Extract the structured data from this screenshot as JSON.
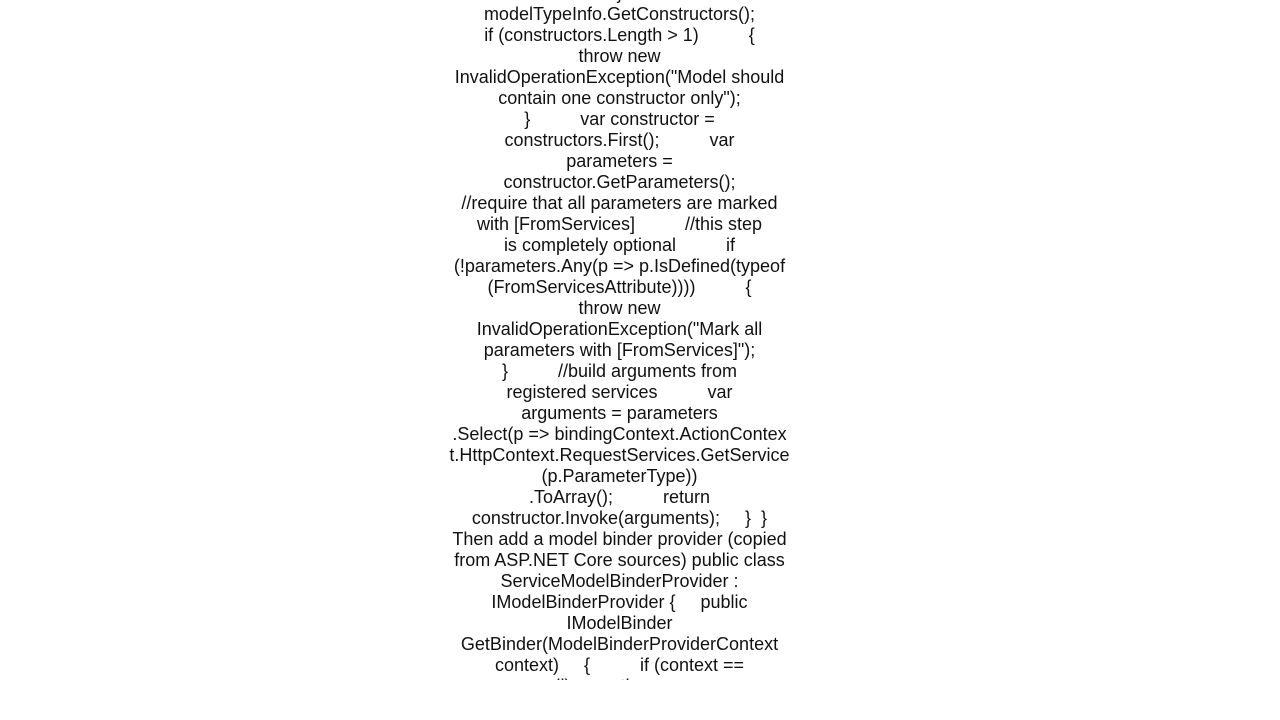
{
  "document": {
    "lines": [
      "}",
      "modelTypeInfo.GetConstructors();",
      "if (constructors.Length > 1)          {",
      "throw new",
      "InvalidOperationException(\"Model should",
      "contain one constructor only\");",
      "}          var constructor =",
      "constructors.First();          var",
      "parameters =",
      "constructor.GetParameters();",
      "//require that all parameters are marked",
      "with [FromServices]          //this step",
      "is completely optional          if",
      "(!parameters.Any(p => p.IsDefined(typeof",
      "(FromServicesAttribute))))          {",
      "throw new",
      "InvalidOperationException(\"Mark all",
      "parameters with [FromServices]\");",
      "}          //build arguments from",
      "registered services          var",
      "arguments = parameters",
      ".Select(p => bindingContext.ActionContex",
      "t.HttpContext.RequestServices.GetService",
      "(p.ParameterType))",
      ".ToArray();          return",
      "constructor.Invoke(arguments);     }  }",
      "Then add a model binder provider (copied",
      "from ASP.NET Core sources) public class",
      "ServiceModelBinderProvider :",
      "IModelBinderProvider {     public",
      "IModelBinder",
      "GetBinder(ModelBinderProviderContext",
      "context)     {          if (context ==",
      "null)          throw new"
    ]
  }
}
